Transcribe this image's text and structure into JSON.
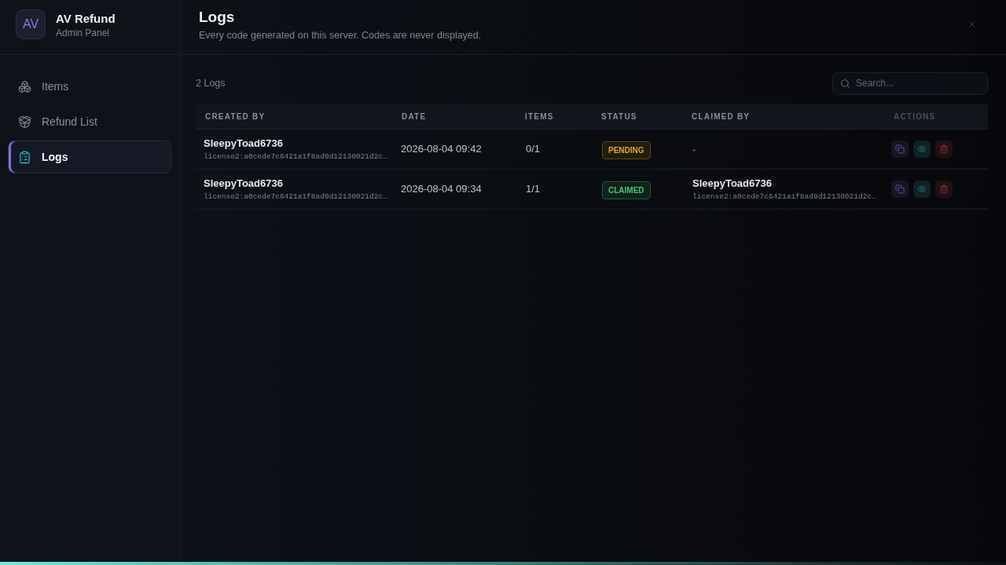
{
  "sidebar": {
    "logo_text": "AV",
    "title": "AV Refund",
    "subtitle": "Admin Panel",
    "items": [
      {
        "label": "Items",
        "selected": false
      },
      {
        "label": "Refund List",
        "selected": false
      },
      {
        "label": "Logs",
        "selected": true
      }
    ]
  },
  "header": {
    "title": "Logs",
    "subtitle": "Every code generated on this server. Codes are never displayed."
  },
  "toolbar": {
    "count": "2 Logs",
    "search": {
      "placeholder": "Search..."
    }
  },
  "table": {
    "columns": [
      "CREATED BY",
      "DATE",
      "ITEMS",
      "STATUS",
      "CLAIMED BY",
      "ACTIONS"
    ],
    "rows": [
      {
        "created_by": {
          "name": "SleepyToad6736",
          "license": "license2:a0cede7c6421a1f8ad9d12138021d2c…"
        },
        "date": "2026-08-04 09:42",
        "items": "0/1",
        "status": {
          "label": "PENDING",
          "kind": "pending"
        },
        "claimed_by": {
          "text": "-"
        }
      },
      {
        "created_by": {
          "name": "SleepyToad6736",
          "license": "license2:a0cede7c6421a1f8ad9d12138021d2c…"
        },
        "date": "2026-08-04 09:34",
        "items": "1/1",
        "status": {
          "label": "CLAIMED",
          "kind": "claimed"
        },
        "claimed_by": {
          "name": "SleepyToad6736",
          "license": "license2:a0cede7c6421a1f8ad9d12138021d2c…"
        }
      }
    ]
  }
}
